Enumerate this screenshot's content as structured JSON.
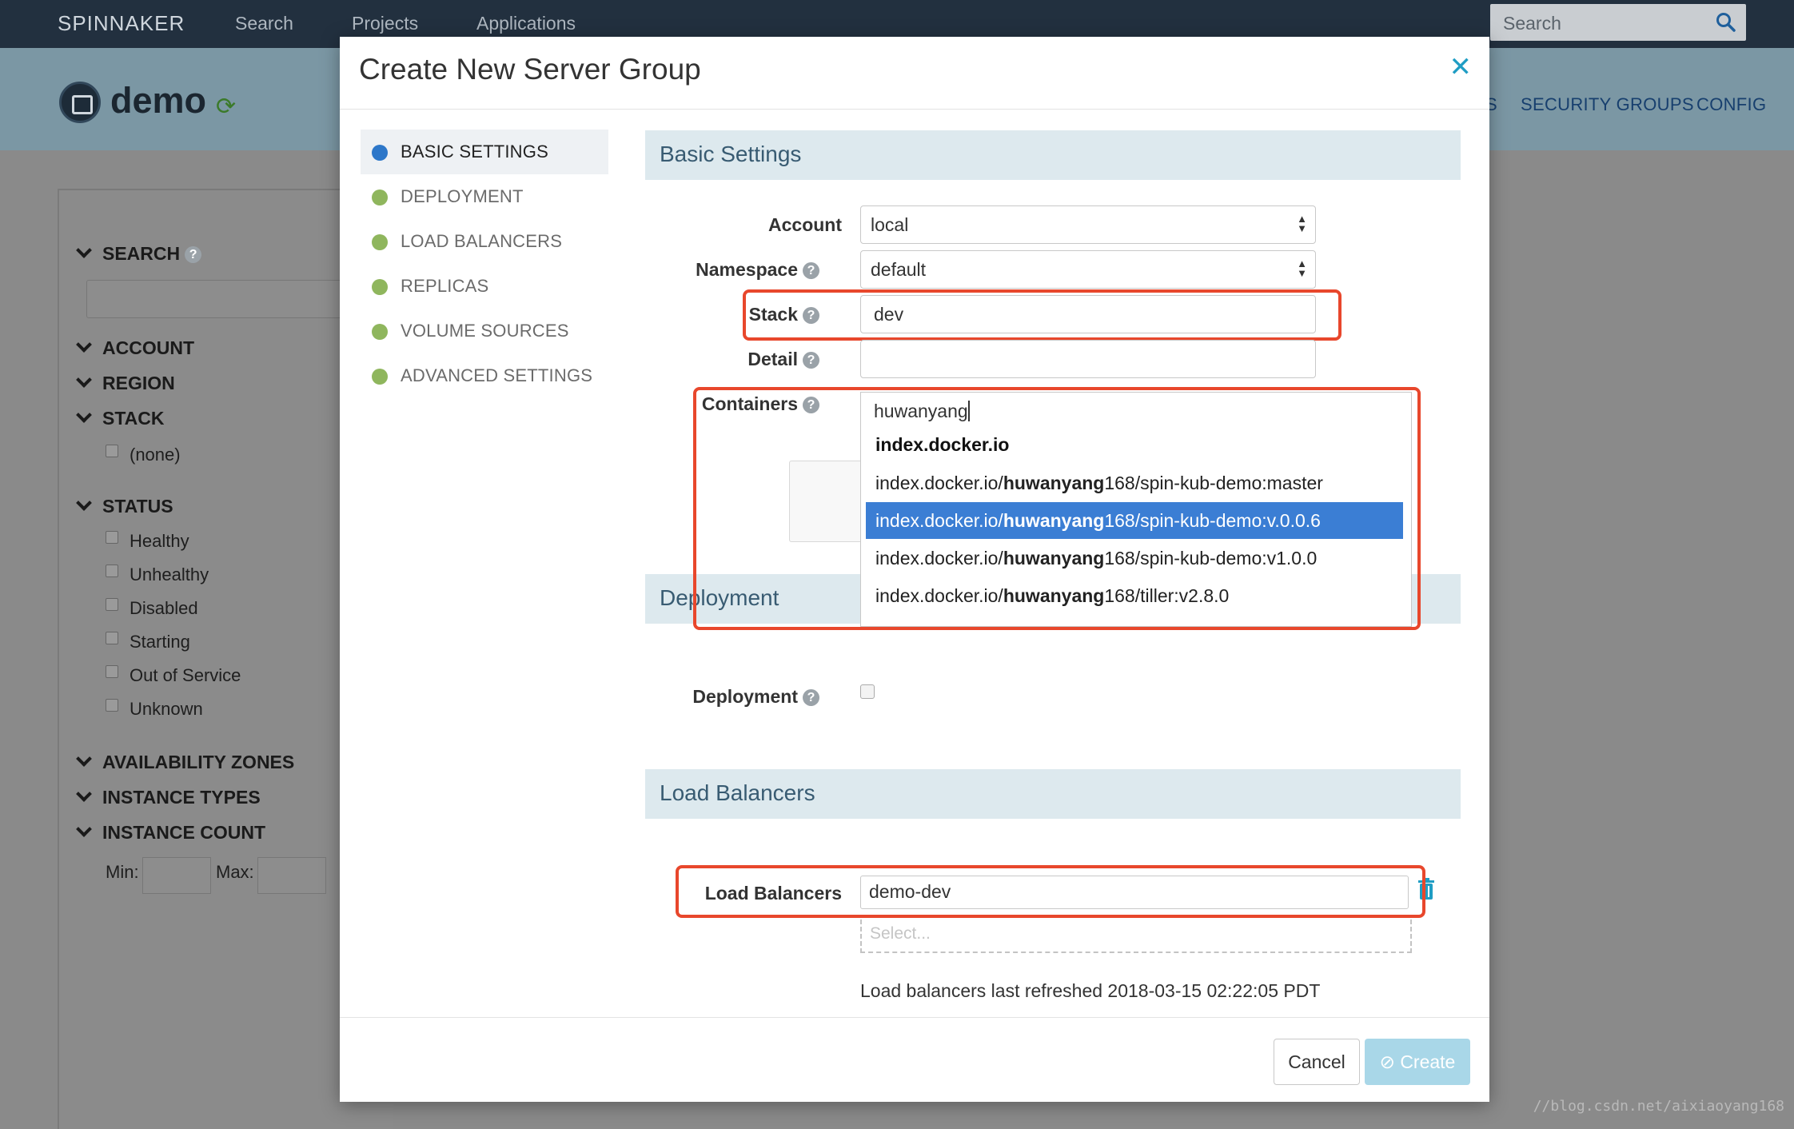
{
  "topnav": {
    "brand": "SPINNAKER",
    "links": [
      "Search",
      "Projects",
      "Applications"
    ],
    "search_placeholder": "Search"
  },
  "app": {
    "name": "demo",
    "tabs": [
      "S",
      "SECURITY GROUPS",
      "CONFIG"
    ]
  },
  "filters": {
    "search": "SEARCH",
    "account": "ACCOUNT",
    "region": "REGION",
    "stack": "STACK",
    "stack_none": "(none)",
    "status": "STATUS",
    "status_options": [
      "Healthy",
      "Unhealthy",
      "Disabled",
      "Starting",
      "Out of Service",
      "Unknown"
    ],
    "availability_zones": "AVAILABILITY ZONES",
    "instance_types": "INSTANCE TYPES",
    "instance_count": "INSTANCE COUNT",
    "min_label": "Min:",
    "max_label": "Max:"
  },
  "modal": {
    "title": "Create New Server Group",
    "nav": [
      "BASIC SETTINGS",
      "DEPLOYMENT",
      "LOAD BALANCERS",
      "REPLICAS",
      "VOLUME SOURCES",
      "ADVANCED SETTINGS"
    ],
    "basic_settings": {
      "header": "Basic Settings",
      "account_label": "Account",
      "account_value": "local",
      "namespace_label": "Namespace",
      "namespace_value": "default",
      "stack_label": "Stack",
      "stack_value": "dev",
      "detail_label": "Detail",
      "detail_value": "",
      "containers_label": "Containers"
    },
    "containers_dropdown": {
      "typed": "huwanyang",
      "group": "index.docker.io",
      "options": [
        {
          "prefix": "index.docker.io/",
          "match": "huwanyang",
          "suffix": "168/spin-kub-demo:master"
        },
        {
          "prefix": "index.docker.io/",
          "match": "huwanyang",
          "suffix": "168/spin-kub-demo:v.0.0.6"
        },
        {
          "prefix": "index.docker.io/",
          "match": "huwanyang",
          "suffix": "168/spin-kub-demo:v1.0.0"
        },
        {
          "prefix": "index.docker.io/",
          "match": "huwanyang",
          "suffix": "168/tiller:v2.8.0"
        }
      ],
      "selected_index": 1
    },
    "deployment": {
      "header": "Deployment",
      "checkbox_label": "Deployment"
    },
    "load_balancers": {
      "header": "Load Balancers",
      "label": "Load Balancers",
      "value": "demo-dev",
      "select_placeholder": "Select...",
      "refreshed_text": "Load balancers last refreshed 2018-03-15 02:22:05 PDT"
    },
    "buttons": {
      "cancel": "Cancel",
      "create": "Create"
    }
  },
  "watermark": "//blog.csdn.net/aixiaoyang168",
  "colors": {
    "nav_active_dot": "#2d77c9",
    "nav_dot": "#8fb65d",
    "highlight_box": "#e8472c",
    "selected_option": "#3b7ed4",
    "create_button": "#a9d7e8"
  }
}
